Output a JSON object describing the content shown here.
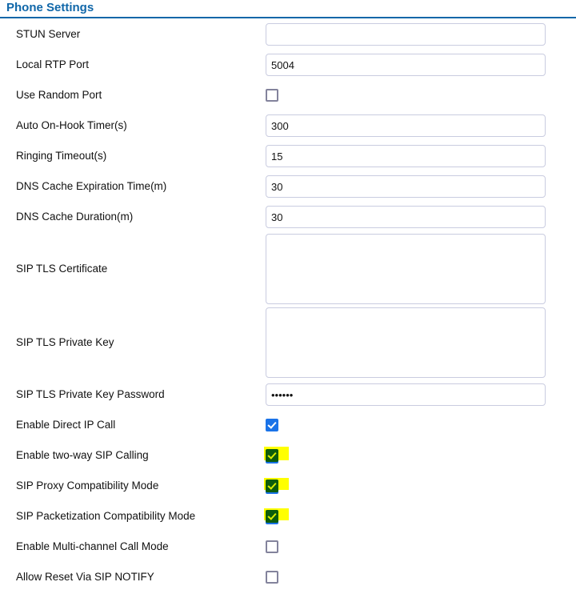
{
  "header": {
    "title": "Phone Settings",
    "accent_color": "#1067a9"
  },
  "colors": {
    "accent": "#1067a9",
    "checkbox_checked": "#1a73e8",
    "checkbox_border": "#83839c",
    "highlight": "#ffff00",
    "highlight_checkbox": "#0c5c0c",
    "input_border": "#c9cce0"
  },
  "form": {
    "rows": [
      {
        "label": "STUN Server",
        "control": "text",
        "value": "",
        "placeholder": "",
        "highlighted": false
      },
      {
        "label": "Local RTP Port",
        "control": "text",
        "value": "5004",
        "placeholder": "",
        "highlighted": false
      },
      {
        "label": "Use Random Port",
        "control": "checkbox",
        "checked": false,
        "highlighted": false
      },
      {
        "label": "Auto On-Hook Timer(s)",
        "control": "text",
        "value": "300",
        "placeholder": "",
        "highlighted": false
      },
      {
        "label": "Ringing Timeout(s)",
        "control": "text",
        "value": "15",
        "placeholder": "",
        "highlighted": false
      },
      {
        "label": "DNS Cache Expiration Time(m)",
        "control": "text",
        "value": "30",
        "placeholder": "",
        "highlighted": false
      },
      {
        "label": "DNS Cache Duration(m)",
        "control": "text",
        "value": "30",
        "placeholder": "",
        "highlighted": false
      },
      {
        "label": "SIP TLS Certificate",
        "control": "textarea",
        "value": "",
        "placeholder": "",
        "highlighted": false
      },
      {
        "label": "SIP TLS Private Key",
        "control": "textarea",
        "value": "",
        "placeholder": "",
        "highlighted": false
      },
      {
        "label": "SIP TLS Private Key Password",
        "control": "password",
        "value": "••••••",
        "placeholder": "",
        "highlighted": false
      },
      {
        "label": "Enable Direct IP Call",
        "control": "checkbox",
        "checked": true,
        "highlighted": false
      },
      {
        "label": "Enable two-way SIP Calling",
        "control": "checkbox",
        "checked": true,
        "highlighted": true
      },
      {
        "label": "SIP Proxy Compatibility Mode",
        "control": "checkbox",
        "checked": true,
        "highlighted": true
      },
      {
        "label": "SIP Packetization Compatibility Mode",
        "control": "checkbox",
        "checked": true,
        "highlighted": true
      },
      {
        "label": "Enable Multi-channel Call Mode",
        "control": "checkbox",
        "checked": false,
        "highlighted": false
      },
      {
        "label": "Allow Reset Via SIP NOTIFY",
        "control": "checkbox",
        "checked": false,
        "highlighted": false
      }
    ]
  }
}
